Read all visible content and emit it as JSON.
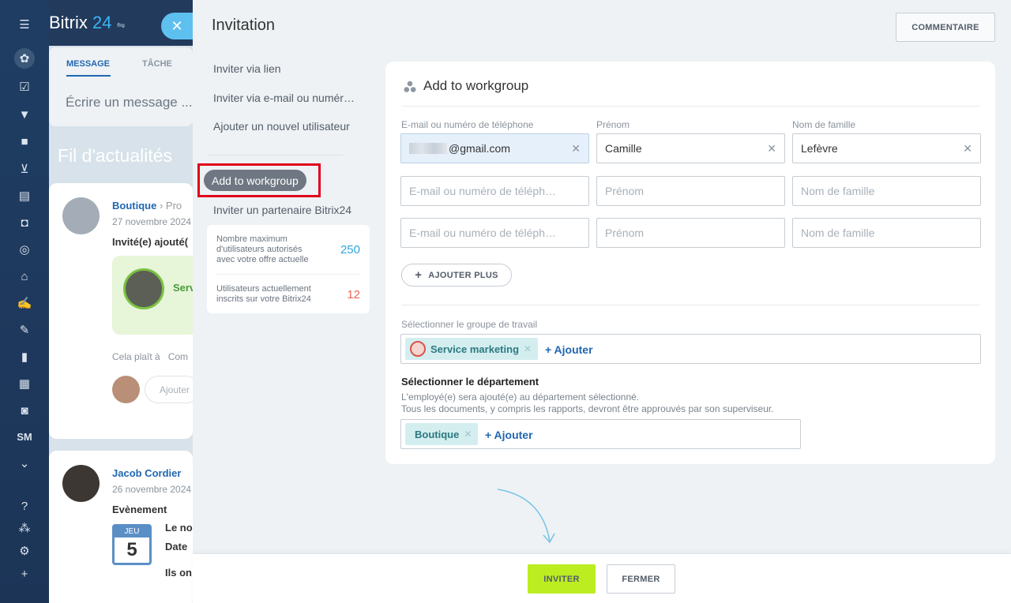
{
  "app": {
    "logo_text": "Bitrix",
    "logo_num": "24",
    "rail_sm": "SM"
  },
  "feed": {
    "tab_message": "MESSAGE",
    "tab_task": "TÂCHE",
    "message_placeholder": "Écrire un message ...",
    "title": "Fil d'actualités",
    "post1": {
      "author": "Boutique",
      "crumb": "Pro",
      "date": "27 novembre 2024",
      "text": "Invité(e) ajouté(",
      "group": "Serv",
      "like": "Cela plaît à",
      "comment": "Com",
      "reply_ph": "Ajouter"
    },
    "post2": {
      "author": "Jacob Cordier",
      "date": "26 novembre 2024",
      "type": "Evènement",
      "cal_day": "JEU",
      "cal_num": "5",
      "line1": "Le no",
      "line2": "Date",
      "line3": "Ils on"
    }
  },
  "modal": {
    "title": "Invitation",
    "comment_button": "COMMENTAIRE",
    "nav": {
      "invite_link": "Inviter via lien",
      "invite_email": "Inviter via e-mail ou numéro de téléphone",
      "add_user": "Ajouter un nouvel utilisateur",
      "add_workgroup": "Add to workgroup",
      "invite_partner": "Inviter un partenaire Bitrix24"
    },
    "info": {
      "max_label": "Nombre maximum d'utilisateurs autorisés avec votre offre actuelle",
      "max_value": "250",
      "current_label": "Utilisateurs actuellement inscrits sur votre Bitrix24",
      "current_value": "12"
    },
    "form": {
      "title": "Add to workgroup",
      "col_email": "E-mail ou numéro de téléphone",
      "col_first": "Prénom",
      "col_last": "Nom de famille",
      "row1": {
        "email": "@gmail.com",
        "first": "Camille",
        "last": "Lefèvre"
      },
      "ph_email": "E-mail ou numéro de téléphone",
      "ph_first": "Prénom",
      "ph_last": "Nom de famille",
      "add_more": "AJOUTER PLUS",
      "group_label": "Sélectionner le groupe de travail",
      "group_tag": "Service marketing",
      "add_link": "+ Ajouter",
      "dept_title": "Sélectionner le département",
      "dept_line1": "L'employé(e) sera ajouté(e) au département sélectionné.",
      "dept_line2": "Tous les documents, y compris les rapports, devront être approuvés par son superviseur.",
      "dept_tag": "Boutique"
    },
    "footer": {
      "invite": "INVITER",
      "close": "FERMER"
    }
  },
  "colors": {
    "accent": "#2067b0",
    "invite_button": "#bbed21",
    "highlight": "#e0001b",
    "max_value": "#2fa6dc",
    "current_value": "#e8675a"
  }
}
